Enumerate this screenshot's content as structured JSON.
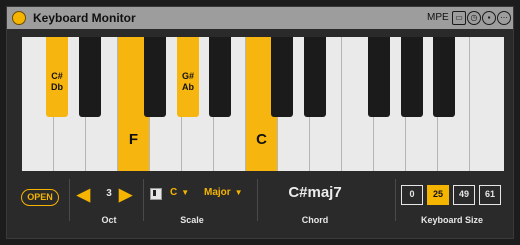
{
  "title": "Keyboard Monitor",
  "mpe_label": "MPE",
  "icons": {
    "power": "power-icon",
    "window": "window-icon",
    "clock": "clock-icon",
    "save": "save-icon",
    "more": "more-icon"
  },
  "colors": {
    "accent": "#f5b400",
    "titlebar": "#9d9d9d",
    "panel": "#2a2a2a"
  },
  "keyboard": {
    "active_white_labels": {
      "f": "F",
      "c": "C"
    },
    "active_black_labels": {
      "cs_line1": "C#",
      "cs_line2": "Db",
      "gs_line1": "G#",
      "gs_line2": "Ab"
    }
  },
  "controls": {
    "open_label": "OPEN",
    "octave": {
      "value": "3",
      "label": "Oct"
    },
    "scale": {
      "root": "C",
      "mode": "Major",
      "label": "Scale"
    },
    "chord": {
      "value": "C#maj7",
      "label": "Chord"
    },
    "keyboard_size": {
      "label": "Keyboard Size",
      "options": [
        "0",
        "25",
        "49",
        "61"
      ],
      "selected": "25"
    }
  }
}
